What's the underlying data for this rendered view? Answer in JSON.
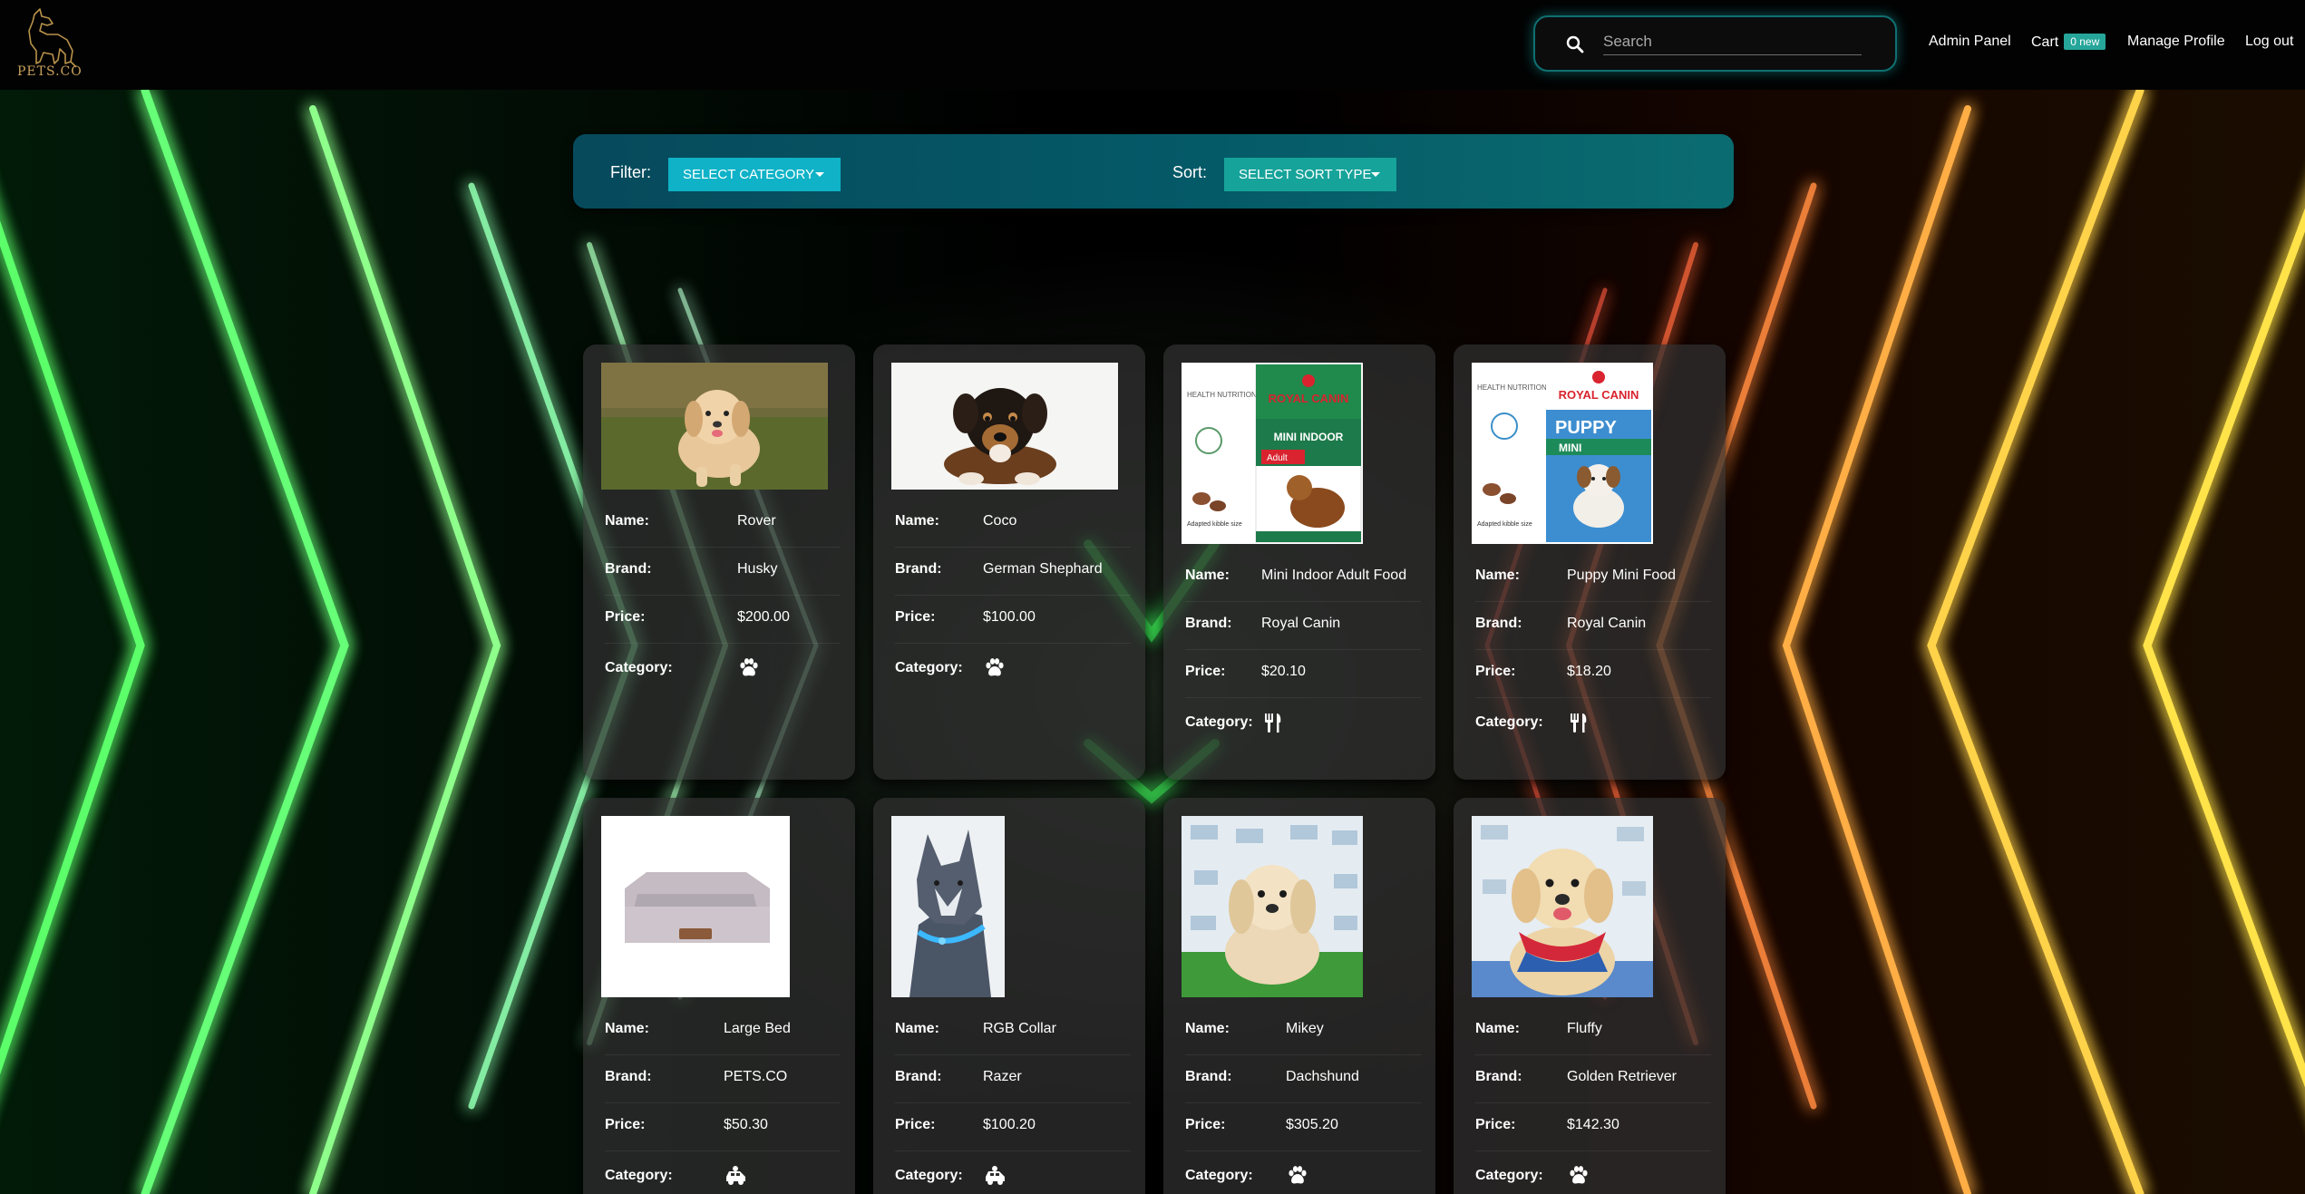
{
  "header": {
    "logo_text": "PETS.CO",
    "search_placeholder": "Search",
    "nav": {
      "admin": "Admin Panel",
      "cart": "Cart",
      "cart_badge": "0 new",
      "profile": "Manage Profile",
      "logout": "Log out"
    }
  },
  "toolbar": {
    "filter_label": "Filter:",
    "filter_value": "SELECT CATEGORY",
    "sort_label": "Sort:",
    "sort_value": "SELECT SORT TYPE"
  },
  "field_labels": {
    "name": "Name:",
    "brand": "Brand:",
    "price": "Price:",
    "category": "Category:"
  },
  "products": [
    {
      "name": "Rover",
      "brand": "Husky",
      "price": "$200.00",
      "category_icon": "paw-icon",
      "image": "puppy-running-on-grass"
    },
    {
      "name": "Coco",
      "brand": "German Shephard",
      "price": "$100.00",
      "category_icon": "paw-icon",
      "image": "puppy-lying-white-background"
    },
    {
      "name": "Mini Indoor Adult Food",
      "brand": "Royal Canin",
      "price": "$20.10",
      "category_icon": "utensils-icon",
      "image": "royal-canin-mini-indoor-bag"
    },
    {
      "name": "Puppy Mini Food",
      "brand": "Royal Canin",
      "price": "$18.20",
      "category_icon": "utensils-icon",
      "image": "royal-canin-puppy-mini-bag"
    },
    {
      "name": "Large Bed",
      "brand": "PETS.CO",
      "price": "$50.30",
      "category_icon": "dog-car-icon",
      "image": "grey-pet-bed"
    },
    {
      "name": "RGB Collar",
      "brand": "Razer",
      "price": "$100.20",
      "category_icon": "dog-car-icon",
      "image": "husky-with-led-collar"
    },
    {
      "name": "Mikey",
      "brand": "Dachshund",
      "price": "$305.20",
      "category_icon": "paw-icon",
      "image": "cream-puppy-sitting"
    },
    {
      "name": "Fluffy",
      "brand": "Golden Retriever",
      "price": "$142.30",
      "category_icon": "paw-icon",
      "image": "golden-puppy-with-bandana"
    }
  ],
  "bag_text": {
    "royal_canin": "ROYAL CANIN",
    "mini_indoor": "MINI INDOOR",
    "adult": "Adult",
    "puppy": "PUPPY",
    "mini": "MINI",
    "health_nutrition": "HEALTH NUTRITION",
    "kibble": "Adapted kibble size"
  },
  "colors": {
    "accent_teal": "#0fb2c7",
    "badge_teal": "#26a69a",
    "neon_green": "#6cff7a",
    "neon_orange": "#ff8a3d",
    "neon_yellow": "#ffe55a"
  }
}
